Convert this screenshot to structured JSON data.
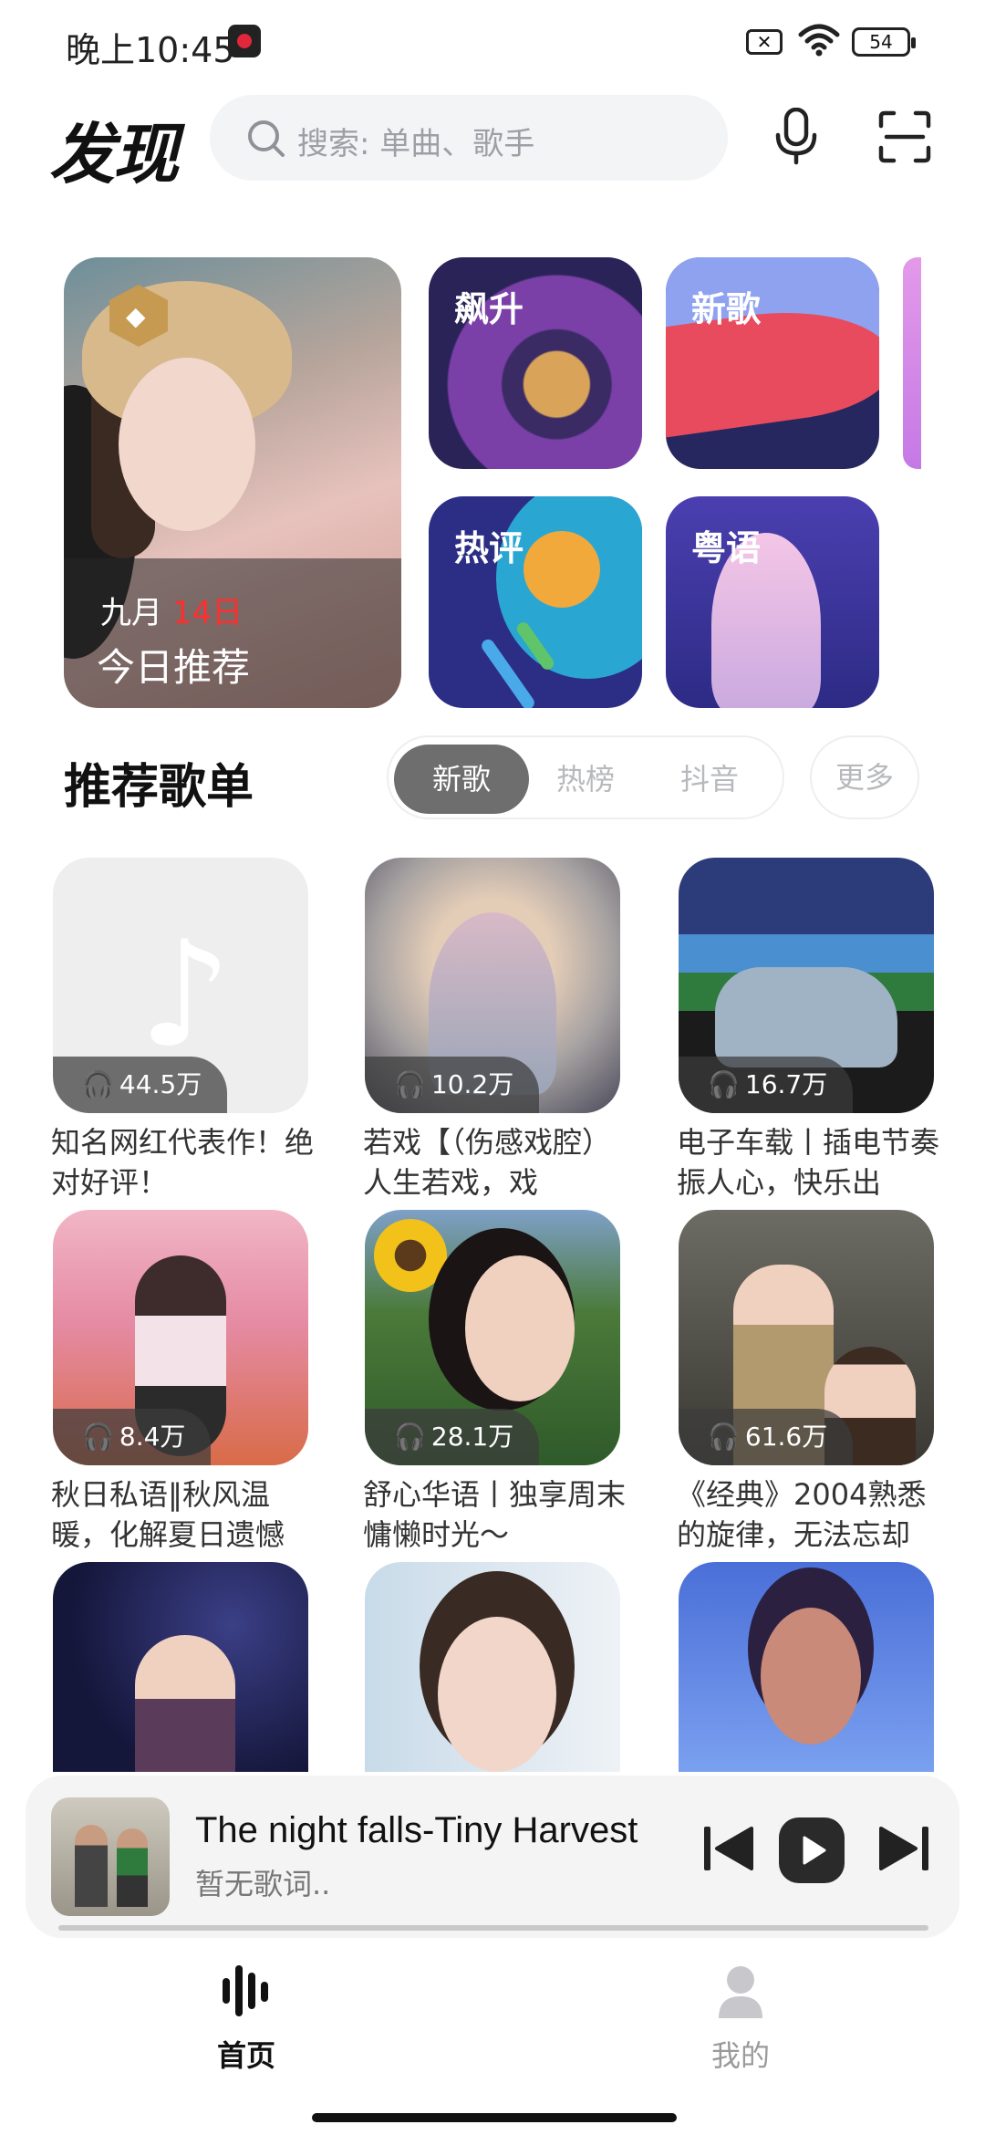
{
  "status_bar": {
    "time": "晚上10:45",
    "battery": "54",
    "sim_badge": "✕"
  },
  "header": {
    "title": "发现",
    "search_placeholder": "搜索: 单曲、歌手"
  },
  "banner": {
    "daily": {
      "month": "九月",
      "day": "14日",
      "label": "今日推荐"
    },
    "cards": [
      "飙升",
      "新歌",
      "热评",
      "粤语"
    ]
  },
  "section": {
    "title": "推荐歌单",
    "tabs": [
      "新歌",
      "热榜",
      "抖音"
    ],
    "active_tab": "新歌",
    "more": "更多"
  },
  "playlists": [
    {
      "plays": "44.5万",
      "name": "知名网红代表作！绝对好评！"
    },
    {
      "plays": "10.2万",
      "name": "若戏【（伤感戏腔）人生若戏，戏"
    },
    {
      "plays": "16.7万",
      "name": "电子车载丨插电节奏振人心，快乐出"
    },
    {
      "plays": "8.4万",
      "name": "秋日私语‖秋风温暖，化解夏日遗憾"
    },
    {
      "plays": "28.1万",
      "name": "舒心华语丨独享周末慵懒时光～"
    },
    {
      "plays": "61.6万",
      "name": "《经典》2004熟悉的旋律，无法忘却"
    },
    {
      "plays": "",
      "name": ""
    },
    {
      "plays": "",
      "name": ""
    },
    {
      "plays": "",
      "name": ""
    }
  ],
  "player": {
    "song": "The night falls-Tiny Harvest",
    "lyric": "暂无歌词.."
  },
  "nav": {
    "home": "首页",
    "me": "我的"
  }
}
